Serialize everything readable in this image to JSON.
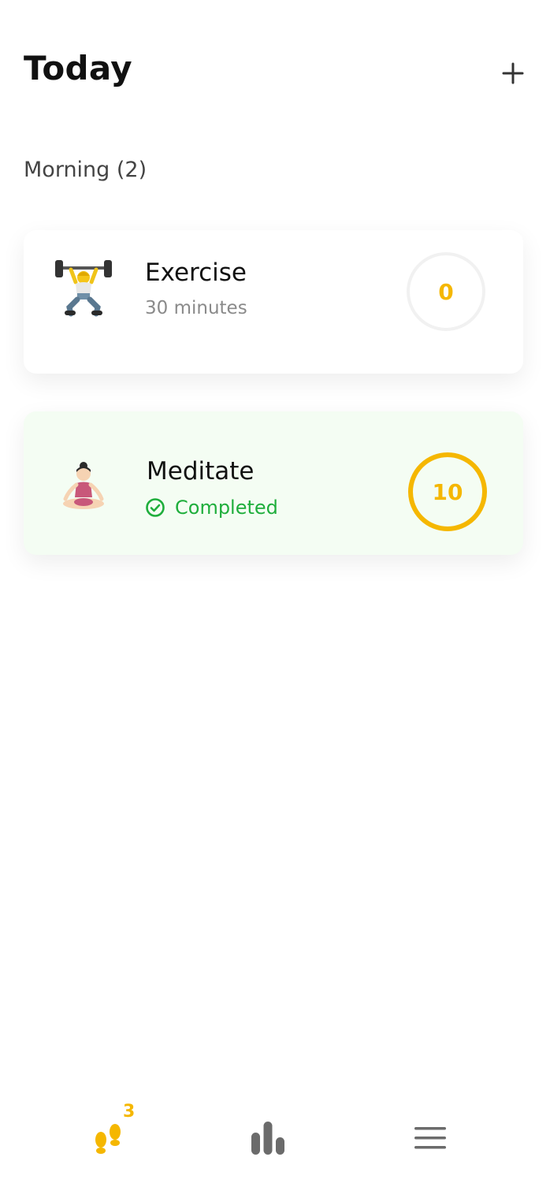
{
  "header": {
    "title": "Today",
    "add_icon": "plus-icon"
  },
  "section": {
    "label": "Morning (2)"
  },
  "habits": [
    {
      "name": "Exercise",
      "subtitle": "30 minutes",
      "emoji": "🏋️",
      "count": "0",
      "completed": false
    },
    {
      "name": "Meditate",
      "status": "Completed",
      "status_icon": "check-circle-icon",
      "emoji": "🧘‍♀️",
      "count": "10",
      "completed": true
    }
  ],
  "nav": {
    "habits_icon": "footsteps-icon",
    "habits_badge": "3",
    "stats_icon": "bar-chart-icon",
    "menu_icon": "menu-icon"
  },
  "colors": {
    "accent": "#f5b700",
    "success": "#1fae3c",
    "completed_card_bg": "#f4fdf3",
    "muted_text": "#8a8a8a",
    "nav_icon": "#6b6b6b"
  }
}
